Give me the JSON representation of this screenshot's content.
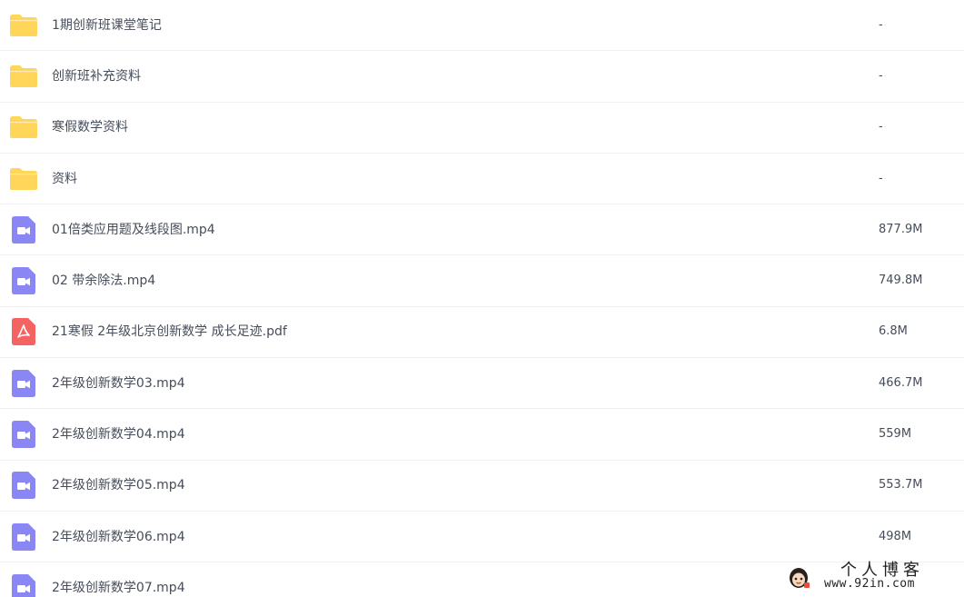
{
  "files": [
    {
      "type": "folder",
      "icon": "folder-icon",
      "name": "1期创新班课堂笔记",
      "size": "-"
    },
    {
      "type": "folder",
      "icon": "folder-icon",
      "name": "创新班补充资料",
      "size": "-"
    },
    {
      "type": "folder",
      "icon": "folder-icon",
      "name": "寒假数学资料",
      "size": "-"
    },
    {
      "type": "folder",
      "icon": "folder-icon",
      "name": "资料",
      "size": "-"
    },
    {
      "type": "video",
      "icon": "video-file-icon",
      "name": "01倍类应用题及线段图.mp4",
      "size": "877.9M"
    },
    {
      "type": "video",
      "icon": "video-file-icon",
      "name": "02 带余除法.mp4",
      "size": "749.8M"
    },
    {
      "type": "pdf",
      "icon": "pdf-file-icon",
      "name": "21寒假 2年级北京创新数学 成长足迹.pdf",
      "size": "6.8M"
    },
    {
      "type": "video",
      "icon": "video-file-icon",
      "name": "2年级创新数学03.mp4",
      "size": "466.7M"
    },
    {
      "type": "video",
      "icon": "video-file-icon",
      "name": "2年级创新数学04.mp4",
      "size": "559M"
    },
    {
      "type": "video",
      "icon": "video-file-icon",
      "name": "2年级创新数学05.mp4",
      "size": "553.7M"
    },
    {
      "type": "video",
      "icon": "video-file-icon",
      "name": "2年级创新数学06.mp4",
      "size": "498M"
    },
    {
      "type": "video",
      "icon": "video-file-icon",
      "name": "2年级创新数学07.mp4",
      "size": ""
    }
  ],
  "colors": {
    "folder": "#ffd659",
    "video": "#8a87f5",
    "pdf": "#f56262",
    "text": "#454d5a",
    "divider": "#f0f1f3"
  },
  "watermark": {
    "title": "个人博客",
    "url": "www.92in.com",
    "avatar_icon": "cartoon-avatar-icon"
  }
}
